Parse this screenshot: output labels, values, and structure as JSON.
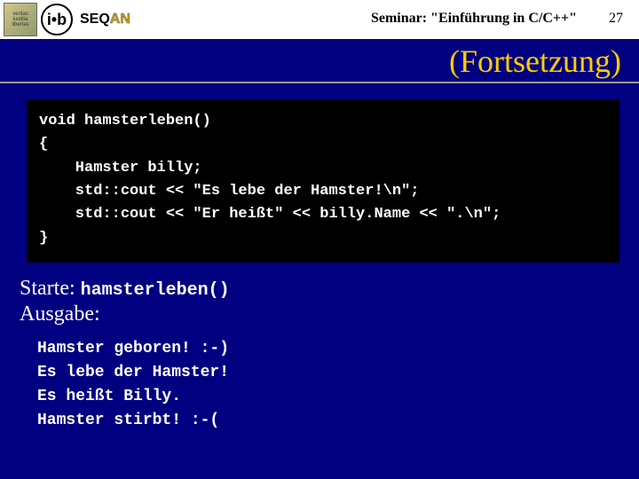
{
  "header": {
    "logo1_text": "veritas\niustitia\nlibertas",
    "logo2_text": "i•b",
    "logo3_seq": "SEQ",
    "logo3_an": "AN",
    "seminar": "Seminar: \"Einführung in C/C++\"",
    "page": "27"
  },
  "title": "(Fortsetzung)",
  "code": "void hamsterleben()\n{\n    Hamster billy;\n    std::cout << \"Es lebe der Hamster!\\n\";\n    std::cout << \"Er heißt\" << billy.Name << \".\\n\";\n}",
  "starte_label": "Starte:",
  "starte_fn": "hamsterleben()",
  "ausgabe_label": "Ausgabe:",
  "output": "Hamster geboren! :-)\nEs lebe der Hamster!\nEs heißt Billy.\nHamster stirbt! :-("
}
